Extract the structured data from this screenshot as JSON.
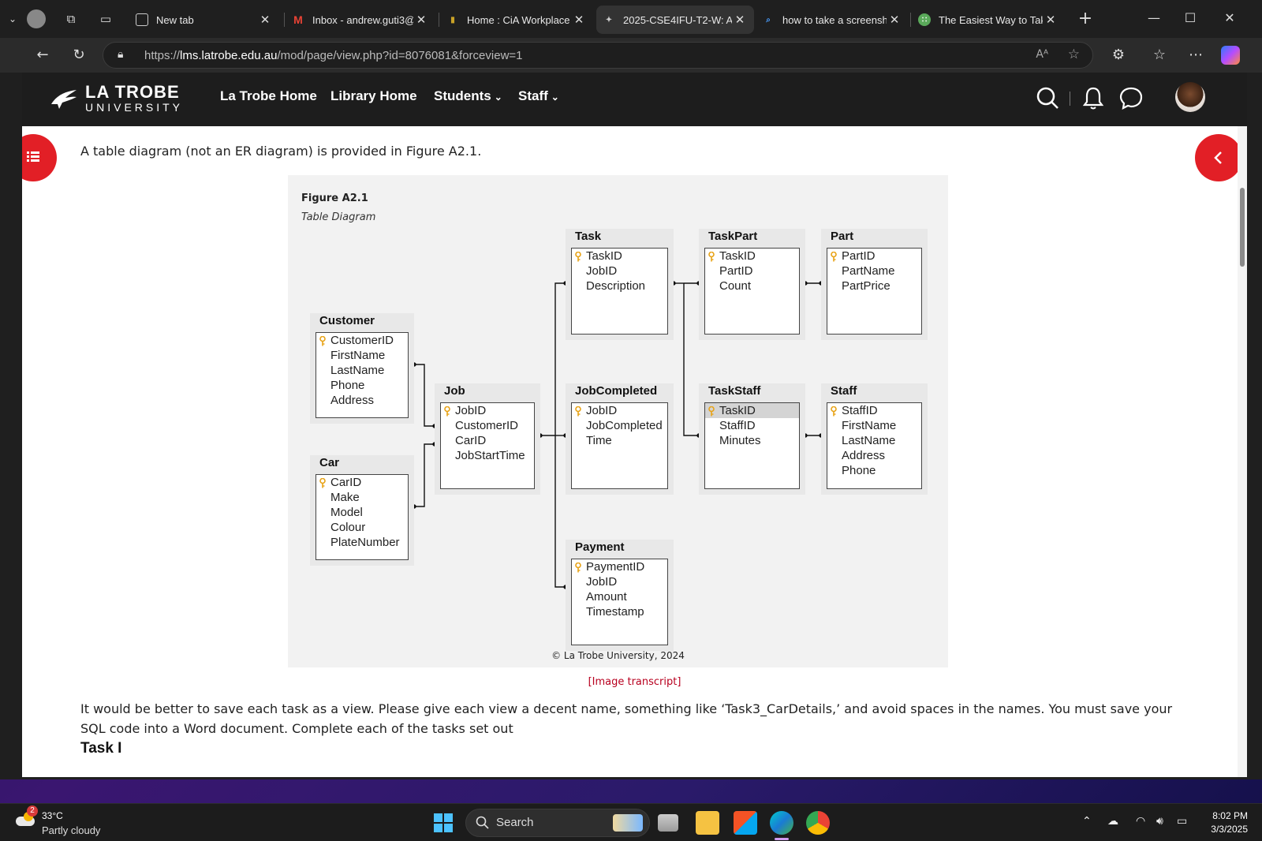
{
  "browser": {
    "tabs": [
      {
        "title": "New tab"
      },
      {
        "title": "Inbox - andrew.guti3@"
      },
      {
        "title": "Home : CiA Workplace"
      },
      {
        "title": "2025-CSE4IFU-T2-W: A"
      },
      {
        "title": "how to take a screensho"
      },
      {
        "title": "The Easiest Way to Take"
      }
    ],
    "url_prefix": "https://",
    "url_host": "lms.latrobe.edu.au",
    "url_path": "/mod/page/view.php?id=8076081&forceview=1"
  },
  "site": {
    "logo_line1": "LA TROBE",
    "logo_line2": "UNIVERSITY",
    "nav": [
      {
        "label": "La Trobe Home"
      },
      {
        "label": "Library Home"
      },
      {
        "label": "Students"
      },
      {
        "label": "Staff"
      }
    ]
  },
  "content": {
    "intro": "A table diagram (not an ER diagram) is provided in Figure A2.1.",
    "figure_title": "Figure A2.1",
    "figure_subtitle": "Table Diagram",
    "tables": [
      {
        "name": "Customer",
        "fields": [
          "CustomerID",
          "FirstName",
          "LastName",
          "Phone",
          "Address"
        ]
      },
      {
        "name": "Car",
        "fields": [
          "CarID",
          "Make",
          "Model",
          "Colour",
          "PlateNumber"
        ]
      },
      {
        "name": "Job",
        "fields": [
          "JobID",
          "CustomerID",
          "CarID",
          "JobStartTime"
        ]
      },
      {
        "name": "Task",
        "fields": [
          "TaskID",
          "JobID",
          "Description"
        ]
      },
      {
        "name": "JobCompleted",
        "fields": [
          "JobID",
          "JobCompleted",
          "Time"
        ]
      },
      {
        "name": "Payment",
        "fields": [
          "PaymentID",
          "JobID",
          "Amount",
          "Timestamp"
        ]
      },
      {
        "name": "TaskPart",
        "fields": [
          "TaskID",
          "PartID",
          "Count"
        ]
      },
      {
        "name": "TaskStaff",
        "fields": [
          "TaskID",
          "StaffID",
          "Minutes"
        ]
      },
      {
        "name": "Part",
        "fields": [
          "PartID",
          "PartName",
          "PartPrice"
        ]
      },
      {
        "name": "Staff",
        "fields": [
          "StaffID",
          "FirstName",
          "LastName",
          "Address",
          "Phone"
        ]
      }
    ],
    "copyright": "© La Trobe University, 2024",
    "transcript_link": "[Image transcript]",
    "paragraph": "It would be better to save each task as a view. Please give each view a decent name, something like ‘Task3_CarDetails,’ and avoid spaces in the names. You must save your SQL code into a Word document. Complete each of the tasks set out",
    "task_heading": "Task I"
  },
  "taskbar": {
    "temperature": "33°C",
    "weather": "Partly cloudy",
    "weather_badge": "2",
    "search_label": "Search",
    "time": "8:02 PM",
    "date": "3/3/2025"
  },
  "colors": {
    "accent_red": "#e21f26",
    "key_gold": "#e8a317",
    "site_header": "#1d1d1d"
  }
}
